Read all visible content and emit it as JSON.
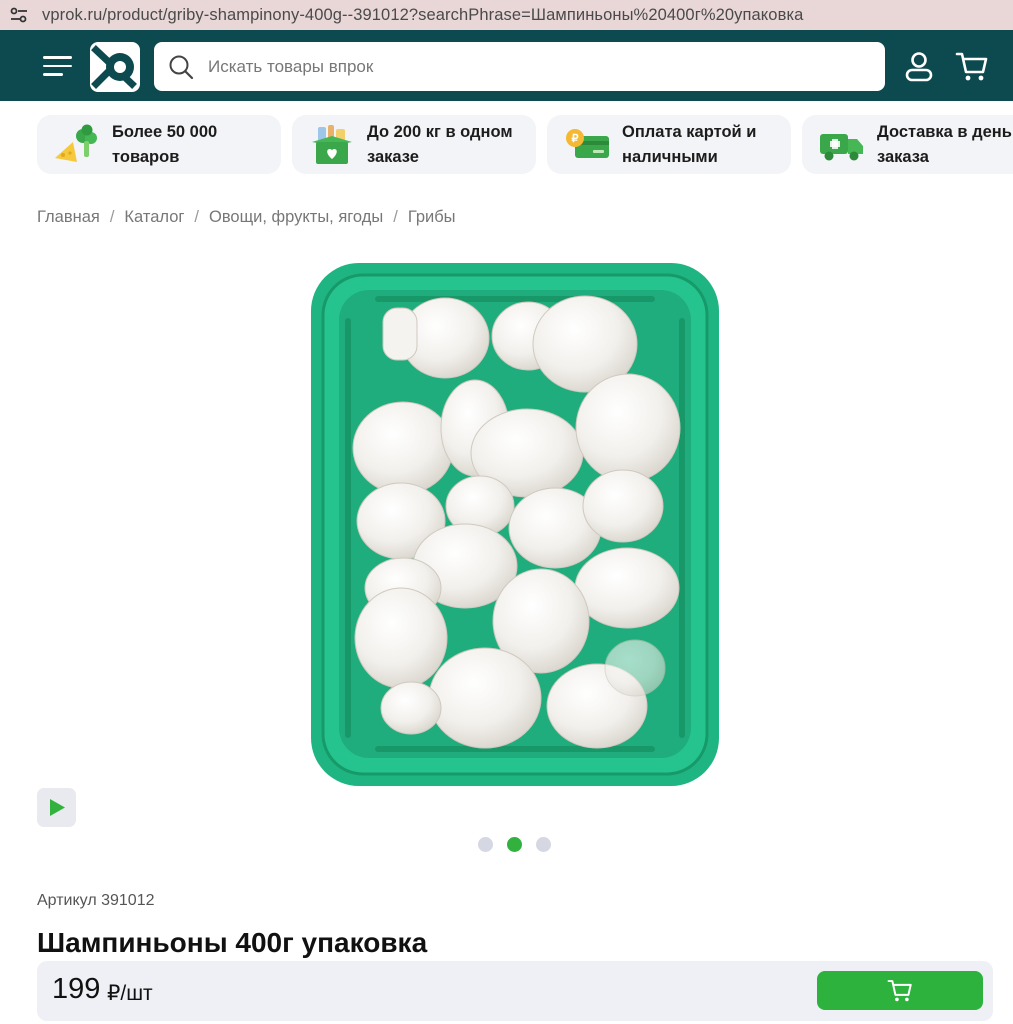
{
  "browser": {
    "url": "vprok.ru/product/griby-shampinony-400g--391012?searchPhrase=Шампиньоны%20400г%20упаковка"
  },
  "header": {
    "search_placeholder": "Искать товары впрок",
    "icons": [
      "menu-icon",
      "logo",
      "search-icon",
      "user-icon",
      "cart-icon"
    ],
    "brand_color": "#0c4a4f"
  },
  "benefits": [
    {
      "icon": "broccoli-cheese-icon",
      "text": "Более 50 000\nтоваров"
    },
    {
      "icon": "grocery-box-icon",
      "text": "До 200 кг в одном\nзаказе"
    },
    {
      "icon": "card-coin-icon",
      "text": "Оплата картой и\nналичными"
    },
    {
      "icon": "delivery-truck-icon",
      "text": "Доставка в день\nзаказа"
    }
  ],
  "breadcrumb": {
    "items": [
      "Главная",
      "Каталог",
      "Овощи, фрукты, ягоды",
      "Грибы"
    ],
    "separator": "/"
  },
  "gallery": {
    "slides": 3,
    "active_slide": 2,
    "play_icon": "play-icon"
  },
  "product": {
    "article": "Артикул 391012",
    "title": "Шампиньоны 400г упаковка",
    "price": "199",
    "unit": "₽/шт",
    "accent_color": "#2db33d"
  }
}
